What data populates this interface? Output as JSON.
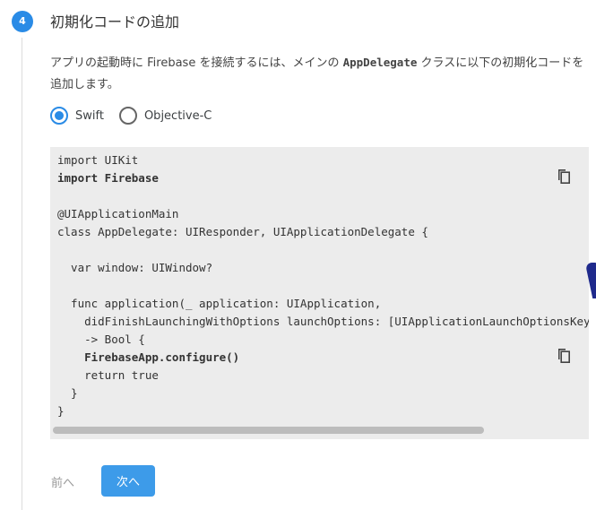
{
  "step": {
    "number": "4",
    "title": "初期化コードの追加"
  },
  "description": {
    "before": "アプリの起動時に Firebase を接続するには、メインの ",
    "code": "AppDelegate",
    "after": " クラスに以下の初期化コードを追加します。"
  },
  "language_options": [
    {
      "label": "Swift",
      "selected": true
    },
    {
      "label": "Objective-C",
      "selected": false
    }
  ],
  "code_lines": [
    {
      "text": "import UIKit",
      "bold": false
    },
    {
      "text": "import Firebase",
      "bold": true
    },
    {
      "text": "",
      "bold": false
    },
    {
      "text": "@UIApplicationMain",
      "bold": false
    },
    {
      "text": "class AppDelegate: UIResponder, UIApplicationDelegate {",
      "bold": false
    },
    {
      "text": "",
      "bold": false
    },
    {
      "text": "  var window: UIWindow?",
      "bold": false
    },
    {
      "text": "",
      "bold": false
    },
    {
      "text": "  func application(_ application: UIApplication,",
      "bold": false
    },
    {
      "text": "    didFinishLaunchingWithOptions launchOptions: [UIApplicationLaunchOptionsKey: Any]?)",
      "bold": false
    },
    {
      "text": "    -> Bool {",
      "bold": false
    },
    {
      "text": "    FirebaseApp.configure()",
      "bold": true
    },
    {
      "text": "    return true",
      "bold": false
    },
    {
      "text": "  }",
      "bold": false
    },
    {
      "text": "}",
      "bold": false
    }
  ],
  "buttons": {
    "prev": "前へ",
    "next": "次へ"
  },
  "colors": {
    "accent": "#2a8be6",
    "next_button": "#3d9be9",
    "code_bg": "#ececec"
  }
}
